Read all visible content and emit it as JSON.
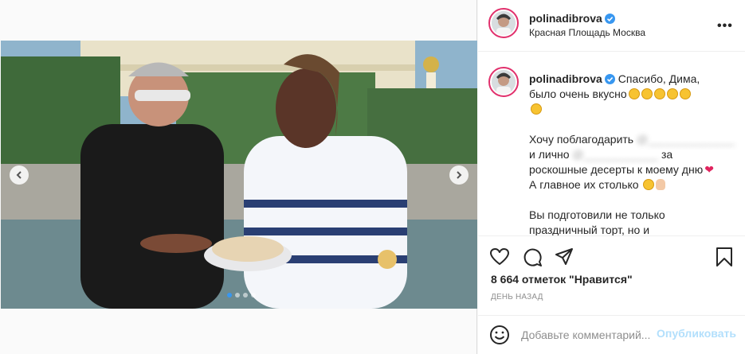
{
  "page": {
    "corner_icon": "download-arrow-icon"
  },
  "post": {
    "author": {
      "username": "polinadibrova",
      "verified": true
    },
    "location": "Красная Площадь Москва",
    "more_icon": "more-options-icon",
    "more_label": "•••",
    "caption": {
      "line1": "Спасибо, Дима,",
      "line2": "было очень вкусно",
      "line3": "Хочу поблагодарить",
      "line4_prefix": "и лично",
      "line4_suffix": "за",
      "line5": "роскошные десерты к моему дню",
      "line6": "А главное их столько",
      "line7": "Вы подготовили не только",
      "line8": "праздничный торт, но и"
    },
    "likes_text": "8 664 отметок \"Нравится\"",
    "time_text": "ДЕНЬ НАЗАД",
    "comment_placeholder": "Добавьте комментарий...",
    "publish_label": "Опубликовать",
    "carousel": {
      "slides": 4,
      "active": 1
    }
  },
  "colors": {
    "accent": "#3897f0",
    "verified": "#3897f0",
    "heart": "#e0245e",
    "publish_disabled": "#b2dffc"
  }
}
